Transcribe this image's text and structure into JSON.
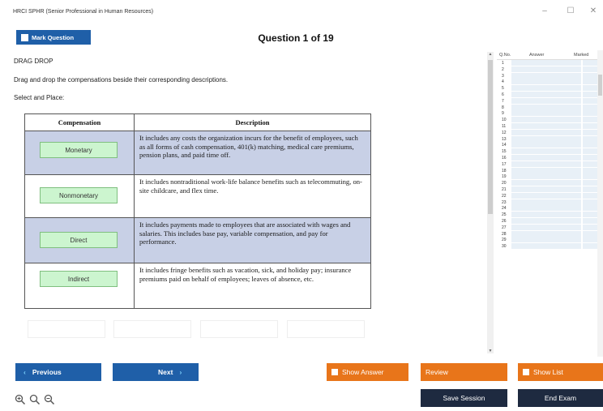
{
  "window": {
    "title": "HRCI SPHR (Senior Professional in Human Resources)",
    "min_symbol": "–",
    "max_symbol": "☐",
    "close_symbol": "✕"
  },
  "header": {
    "mark_label": "Mark Question",
    "question_title": "Question 1 of 19"
  },
  "question": {
    "type_label": "DRAG DROP",
    "instruction": "Drag and drop the compensations beside their corresponding descriptions.",
    "select_place": "Select and Place:",
    "table": {
      "headers": [
        "Compensation",
        "Description"
      ],
      "rows": [
        {
          "compensation": "Monetary",
          "description": "It includes any costs the organization incurs for the benefit of employees, such as all forms of cash compensation, 401(k) matching, medical care premiums, pension plans, and paid time off."
        },
        {
          "compensation": "Nonmonetary",
          "description": "It includes nontraditional work-life balance benefits such as telecommuting, on-site childcare, and flex time."
        },
        {
          "compensation": "Direct",
          "description": "It includes payments made to employees that are associated with wages and salaries. This includes base pay, variable compensation, and pay for performance."
        },
        {
          "compensation": "Indirect",
          "description": "It includes fringe benefits such as vacation, sick, and holiday pay; insurance premiums paid on behalf of employees; leaves of absence, etc."
        }
      ]
    }
  },
  "side_panel": {
    "headers": {
      "qno": "Q.No.",
      "answer": "Answer",
      "marked": "Marked"
    },
    "rows": [
      "1",
      "2",
      "3",
      "4",
      "5",
      "6",
      "7",
      "8",
      "9",
      "10",
      "11",
      "12",
      "13",
      "14",
      "15",
      "16",
      "17",
      "18",
      "19",
      "20",
      "21",
      "22",
      "23",
      "24",
      "25",
      "26",
      "27",
      "28",
      "29",
      "30"
    ]
  },
  "footer": {
    "previous_label": "Previous",
    "next_label": "Next",
    "show_answer_label": "Show Answer",
    "review_label": "Review",
    "show_list_label": "Show List",
    "save_session_label": "Save Session",
    "end_exam_label": "End Exam",
    "prev_chevron": "‹",
    "next_chevron": "›"
  },
  "colors": {
    "primary_blue": "#1f5fa8",
    "orange": "#e8751a",
    "dark_navy": "#1e2a40",
    "row_shade": "#c8d0e6",
    "drag_green": "#ccf5cf"
  }
}
